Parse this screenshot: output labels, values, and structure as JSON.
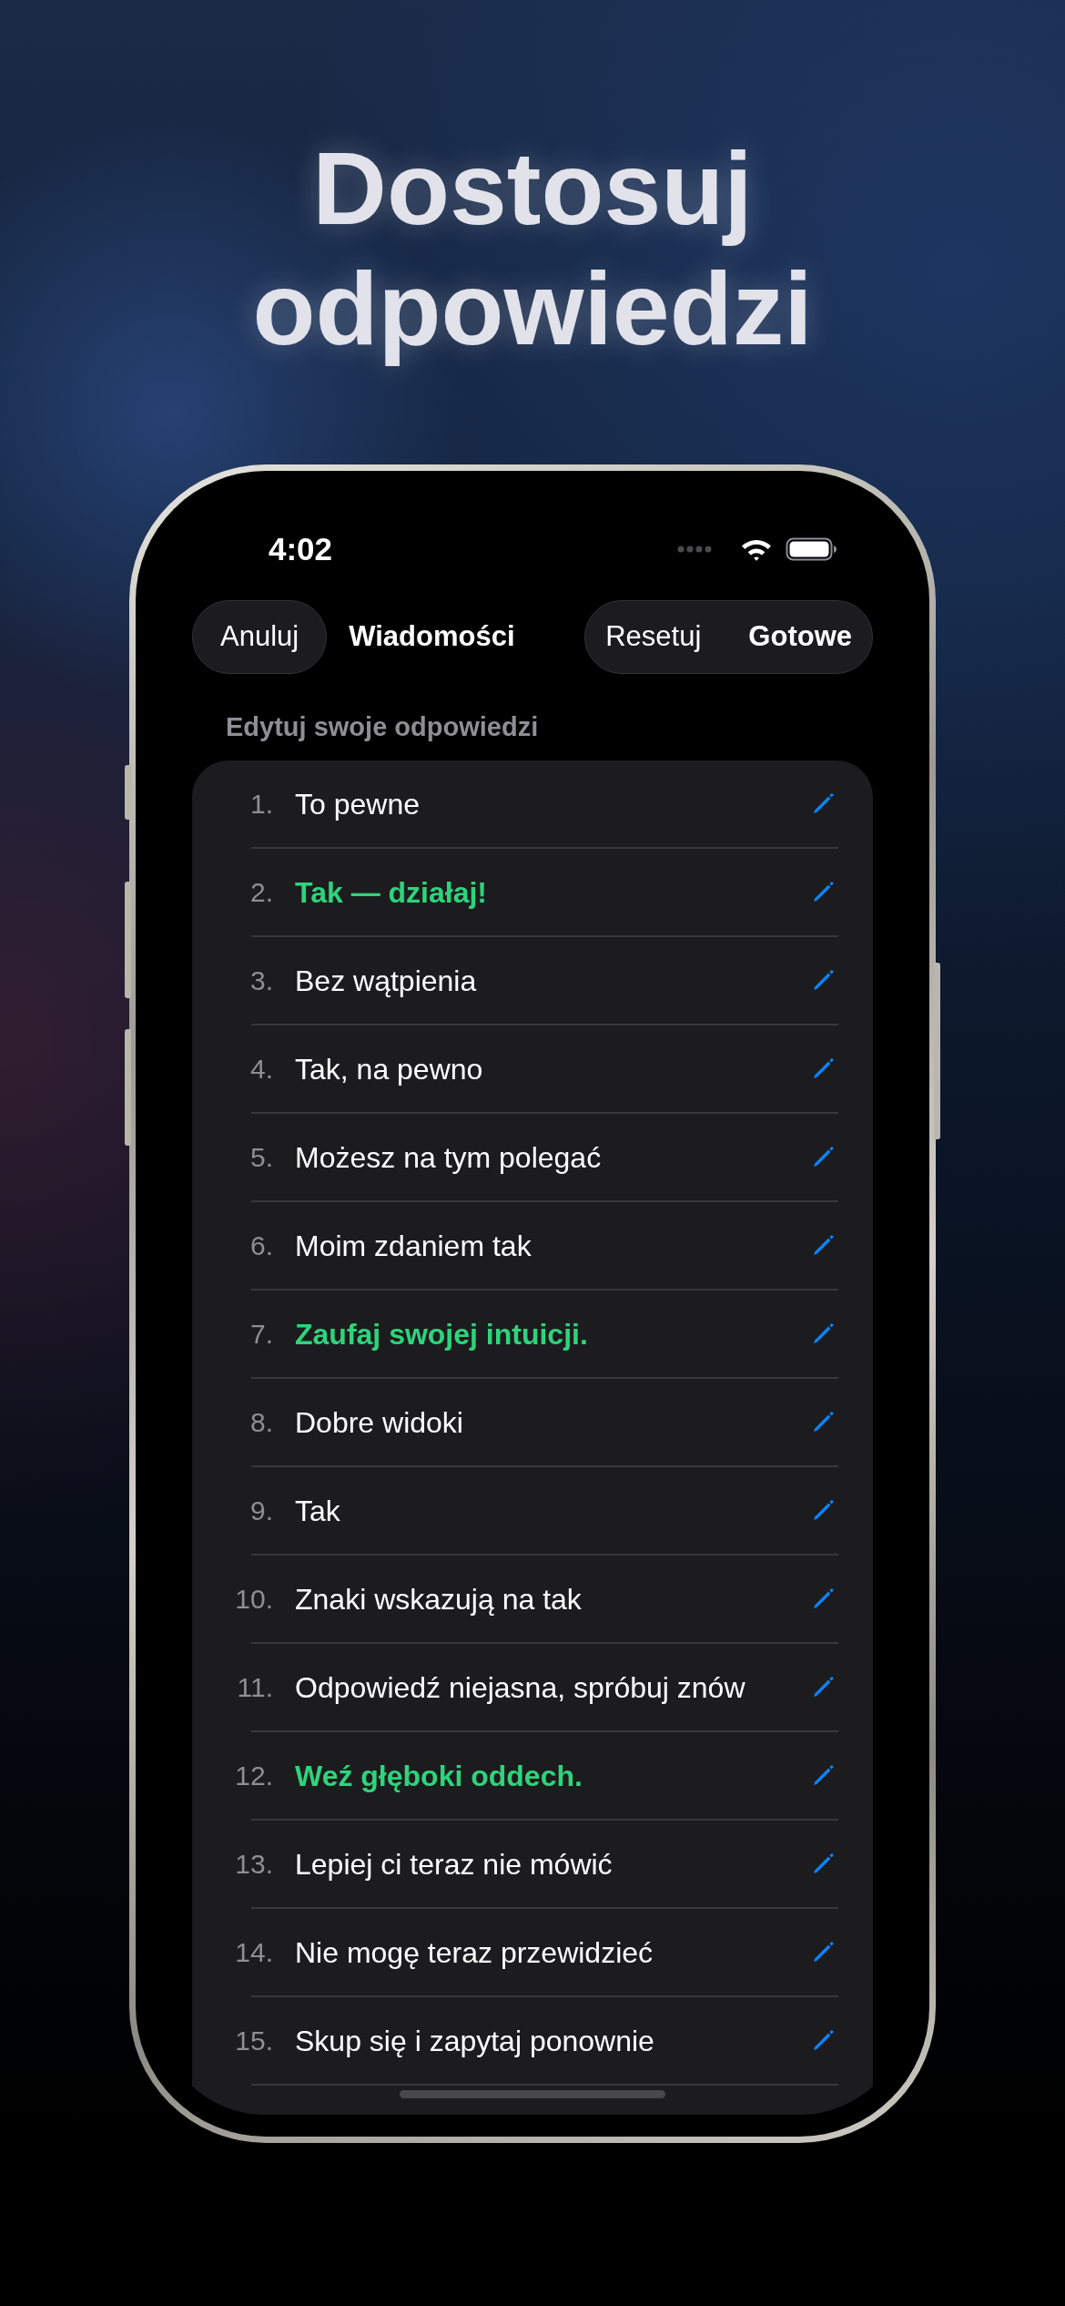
{
  "headline": "Dostosuj odpowiedzi",
  "status_bar": {
    "time": "4:02"
  },
  "nav": {
    "cancel": "Anuluj",
    "title": "Wiadomości",
    "reset": "Resetuj",
    "done": "Gotowe"
  },
  "section": {
    "title": "Edytuj swoje odpowiedzi"
  },
  "answers": [
    {
      "number": "1.",
      "text": "To pewne",
      "kind": "plain"
    },
    {
      "number": "2.",
      "text": "Tak — działaj!",
      "kind": "highlighted"
    },
    {
      "number": "3.",
      "text": "Bez wątpienia",
      "kind": "plain"
    },
    {
      "number": "4.",
      "text": "Tak, na pewno",
      "kind": "plain"
    },
    {
      "number": "5.",
      "text": "Możesz na tym polegać",
      "kind": "plain"
    },
    {
      "number": "6.",
      "text": "Moim zdaniem tak",
      "kind": "plain"
    },
    {
      "number": "7.",
      "text": "Zaufaj swojej intuicji.",
      "kind": "highlighted"
    },
    {
      "number": "8.",
      "text": "Dobre widoki",
      "kind": "plain"
    },
    {
      "number": "9.",
      "text": "Tak",
      "kind": "plain"
    },
    {
      "number": "10.",
      "text": "Znaki wskazują na tak",
      "kind": "plain"
    },
    {
      "number": "11.",
      "text": "Odpowiedź niejasna, spróbuj znów",
      "kind": "plain"
    },
    {
      "number": "12.",
      "text": "Weź głęboki oddech.",
      "kind": "highlighted"
    },
    {
      "number": "13.",
      "text": "Lepiej ci teraz nie mówić",
      "kind": "plain"
    },
    {
      "number": "14.",
      "text": "Nie mogę teraz przewidzieć",
      "kind": "plain"
    },
    {
      "number": "15.",
      "text": "Skup się i zapytaj ponownie",
      "kind": "plain"
    }
  ]
}
